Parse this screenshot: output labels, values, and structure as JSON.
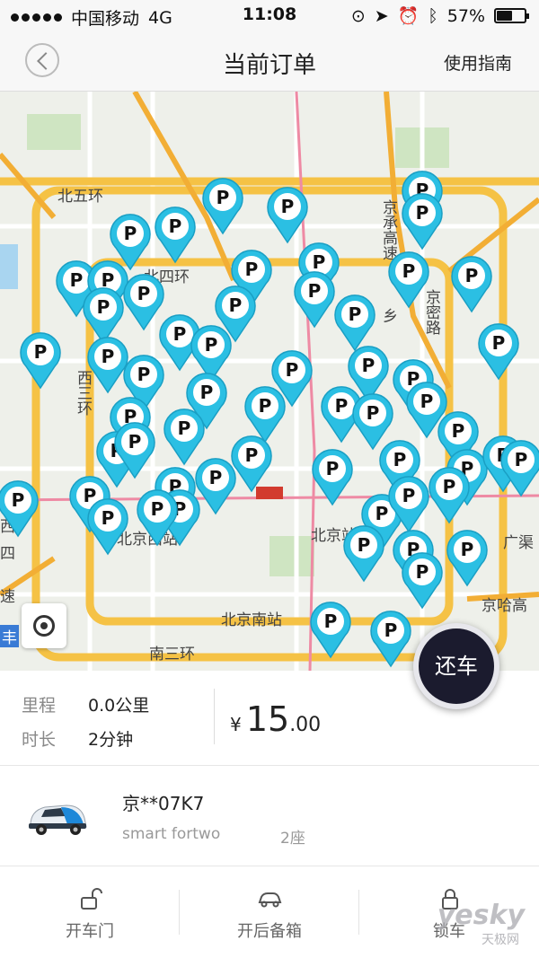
{
  "status_bar": {
    "carrier": "中国移动",
    "network": "4G",
    "time": "11:08",
    "battery": "57%",
    "battery_level": 0.57
  },
  "nav": {
    "title": "当前订单",
    "guide": "使用指南"
  },
  "map": {
    "labels": [
      "北五环",
      "北四环",
      "西三环",
      "北京西站",
      "北京站",
      "北京南站",
      "南三环",
      "广渠",
      "京哈高",
      "京承高速",
      "京密路",
      "乡",
      "西",
      "丰",
      "四",
      "速"
    ],
    "pin_label": "P"
  },
  "return_button": "还车",
  "trip": {
    "distance_label": "里程",
    "distance_value": "0.0公里",
    "duration_label": "时长",
    "duration_value": "2分钟",
    "currency": "¥",
    "price_int": "15",
    "price_dec": ".00"
  },
  "vehicle": {
    "plate": "京**07K7",
    "model": "smart fortwo",
    "seats": "2座"
  },
  "actions": [
    {
      "label": "开车门",
      "icon": "unlock-icon"
    },
    {
      "label": "开后备箱",
      "icon": "car-trunk-icon"
    },
    {
      "label": "锁车",
      "icon": "lock-icon"
    }
  ],
  "watermark": {
    "main": "yesky",
    "sub": "天极网"
  },
  "colors": {
    "pin": "#2bbfe3",
    "return_bg": "#1b1b2e",
    "road_major": "#f5c245",
    "road_ring": "#f0a830"
  }
}
